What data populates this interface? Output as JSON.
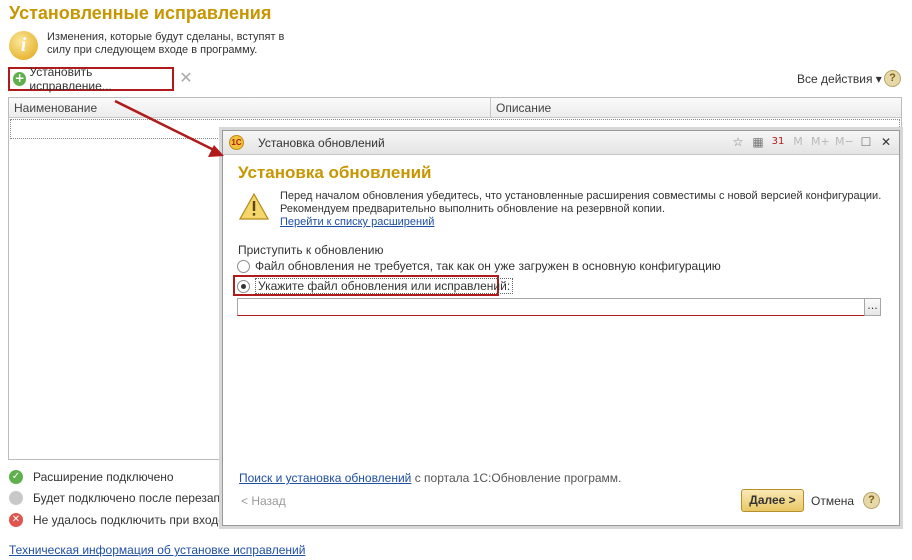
{
  "page": {
    "title": "Установленные исправления",
    "info_text": "Изменения, которые будут сделаны, вступят в силу при следующем входе в программу.",
    "toolbar": {
      "install_label": "Установить исправление...",
      "all_actions_label": "Все действия ▾",
      "help_label": "?"
    },
    "table": {
      "columns": [
        "Наименование",
        "Описание"
      ]
    },
    "legend": [
      {
        "label": "Расширение подключено",
        "color": "#5fb04c"
      },
      {
        "label": "Будет подключено после перезапуска",
        "color": "#c8c8c8"
      },
      {
        "label": "Не удалось подключить при входе в программу",
        "color": "#e0544e"
      }
    ],
    "tech_link": "Техническая информация об установке исправлений"
  },
  "dialog": {
    "window_title": "Установка обновлений",
    "logo_text": "1С",
    "toolbar_icons": [
      "favorite-icon",
      "calculator-icon",
      "calendar-icon",
      "M",
      "M+",
      "M−",
      "maximize-icon",
      "close-icon"
    ],
    "heading": "Установка обновлений",
    "warning_line1": "Перед началом обновления убедитесь, что установленные расширения совместимы с новой версией конфигурации.",
    "warning_line2": "Рекомендуем предварительно выполнить обновление на резервной копии.",
    "extensions_link": "Перейти к списку расширений",
    "proceed_label": "Приступить к обновлению",
    "option_not_required": "Файл обновления не требуется, так как он уже загружен в основную конфигурацию",
    "option_specify_file": "Укажите файл обновления или исправлений:",
    "file_value": "",
    "file_btn_label": "...",
    "footer_link": "Поиск и установка обновлений",
    "footer_suffix": " с портала 1С:Обновление программ.",
    "back_label": "< Назад",
    "next_label": "Далее >",
    "cancel_label": "Отмена",
    "help_label": "?"
  },
  "colors": {
    "title_gold": "#c79600",
    "link_blue": "#1f4fa3",
    "highlight_red": "#b01a1a"
  }
}
